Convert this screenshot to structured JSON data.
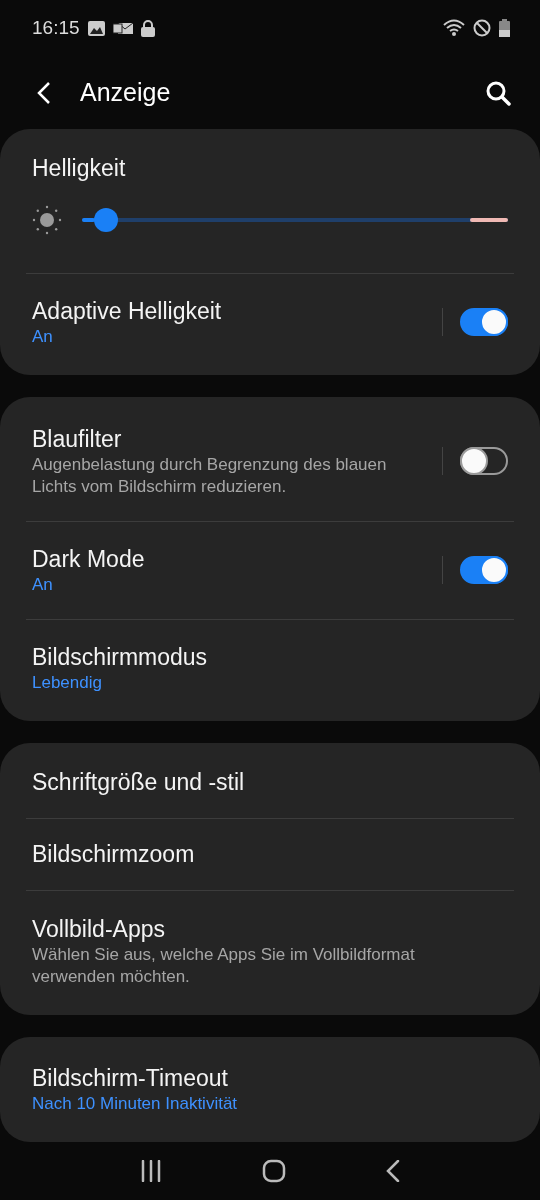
{
  "status_bar": {
    "time": "16:15"
  },
  "header": {
    "title": "Anzeige"
  },
  "groups": [
    {
      "items": [
        {
          "kind": "slider",
          "title": "Helligkeit",
          "level": 0.03
        },
        {
          "kind": "toggle",
          "title": "Adaptive Helligkeit",
          "value": "An",
          "on": true
        }
      ]
    },
    {
      "items": [
        {
          "kind": "toggle",
          "title": "Blaufilter",
          "description": "Augenbelastung durch Begrenzung des blauen Lichts vom Bildschirm reduzieren.",
          "on": false
        },
        {
          "kind": "toggle",
          "title": "Dark Mode",
          "value": "An",
          "on": true
        },
        {
          "kind": "link",
          "title": "Bildschirmmodus",
          "value": "Lebendig"
        }
      ]
    },
    {
      "items": [
        {
          "kind": "link",
          "title": "Schriftgröße und -stil"
        },
        {
          "kind": "link",
          "title": "Bildschirmzoom"
        },
        {
          "kind": "link",
          "title": "Vollbild-Apps",
          "description": "Wählen Sie aus, welche Apps Sie im Vollbildformat verwenden möchten."
        }
      ]
    },
    {
      "items": [
        {
          "kind": "link",
          "title": "Bildschirm-Timeout",
          "value": "Nach 10 Minuten Inaktivität"
        }
      ]
    }
  ]
}
